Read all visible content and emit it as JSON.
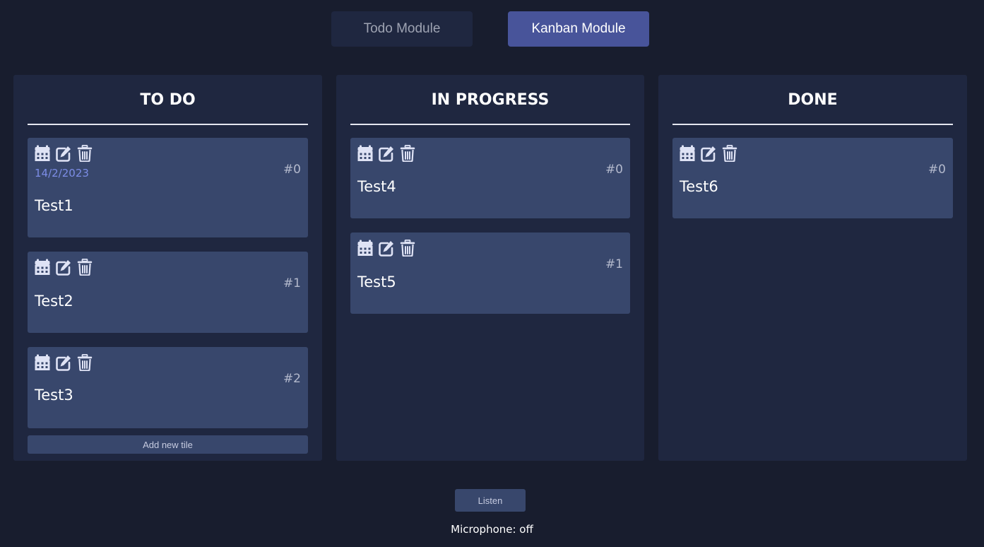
{
  "nav": {
    "todo_label": "Todo Module",
    "kanban_label": "Kanban Module"
  },
  "columns": [
    {
      "title": "TO DO",
      "add_label": "Add new tile",
      "tiles": [
        {
          "num": "#0",
          "date": "14/2/2023",
          "text": "Test1"
        },
        {
          "num": "#1",
          "text": "Test2"
        },
        {
          "num": "#2",
          "text": "Test3"
        }
      ]
    },
    {
      "title": "IN PROGRESS",
      "tiles": [
        {
          "num": "#0",
          "text": "Test4"
        },
        {
          "num": "#1",
          "text": "Test5"
        }
      ]
    },
    {
      "title": "DONE",
      "tiles": [
        {
          "num": "#0",
          "text": "Test6"
        }
      ]
    }
  ],
  "footer": {
    "listen_label": "Listen",
    "mic_status": "Microphone: off"
  },
  "icons": [
    "calendar-icon",
    "edit-icon",
    "trash-icon"
  ],
  "colors": {
    "background": "#181d2e",
    "column": "#1f2740",
    "tile": "#38476c",
    "active_nav": "#48549a",
    "date": "#7c8de6"
  }
}
